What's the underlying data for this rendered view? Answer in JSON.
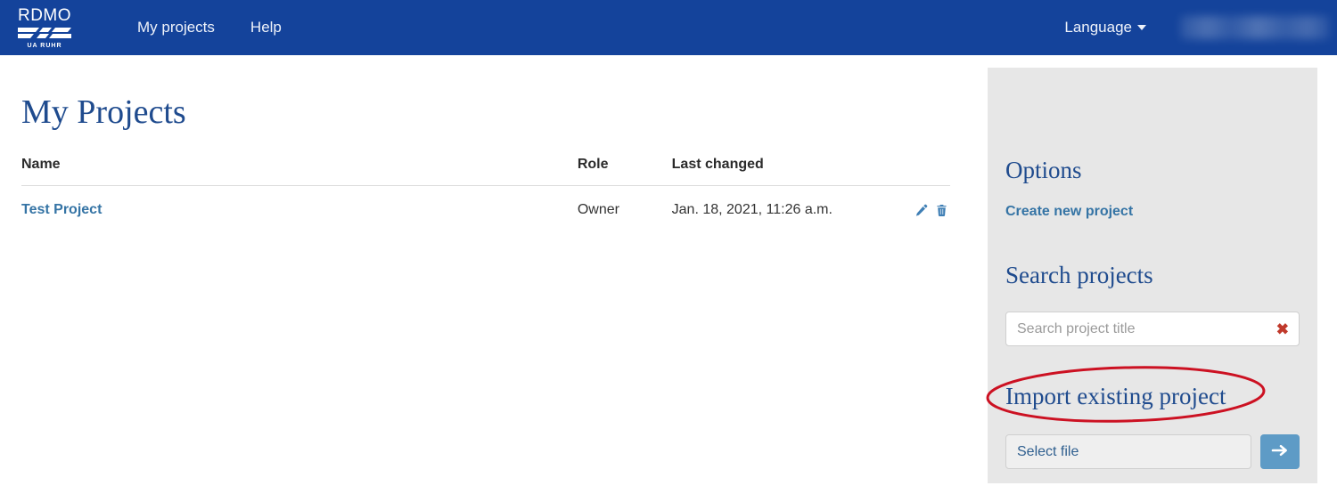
{
  "navbar": {
    "brand_text": "RDMO",
    "brand_sub": "UA RUHR",
    "brand_logo_icon": "ua-ruhr-logo",
    "links": [
      {
        "label": "My projects"
      },
      {
        "label": "Help"
      }
    ],
    "language_label": "Language",
    "language_caret_icon": "caret-down-icon",
    "user_menu_label": "",
    "background_color": "#14439b"
  },
  "main": {
    "page_title": "My Projects",
    "table": {
      "columns": [
        "Name",
        "Role",
        "Last changed",
        ""
      ],
      "rows": [
        {
          "name": "Test Project",
          "role": "Owner",
          "last_changed": "Jan. 18, 2021, 11:26 a.m.",
          "edit_icon": "pencil-icon",
          "delete_icon": "trash-icon"
        }
      ]
    }
  },
  "sidebar": {
    "background_color": "#e7e7e7",
    "options_heading": "Options",
    "create_project_label": "Create new project",
    "search_heading": "Search projects",
    "search": {
      "value": "",
      "placeholder": "Search project title",
      "clear_icon": "close-x-icon",
      "clear_glyph": "✖"
    },
    "import_heading": "Import existing project",
    "import": {
      "select_file_label": "Select file",
      "submit_icon": "arrow-right-icon"
    }
  },
  "annotation": {
    "shape": "ellipse",
    "target": "Import existing project",
    "color": "#cc1122"
  },
  "colors": {
    "navbar_blue": "#14439b",
    "heading_blue": "#1f4b8e",
    "link_blue": "#3574a5",
    "sidebar_gray": "#e7e7e7",
    "submit_blue": "#5e9bc6",
    "annotation_red": "#cc1122",
    "clear_red": "#c0392b"
  }
}
